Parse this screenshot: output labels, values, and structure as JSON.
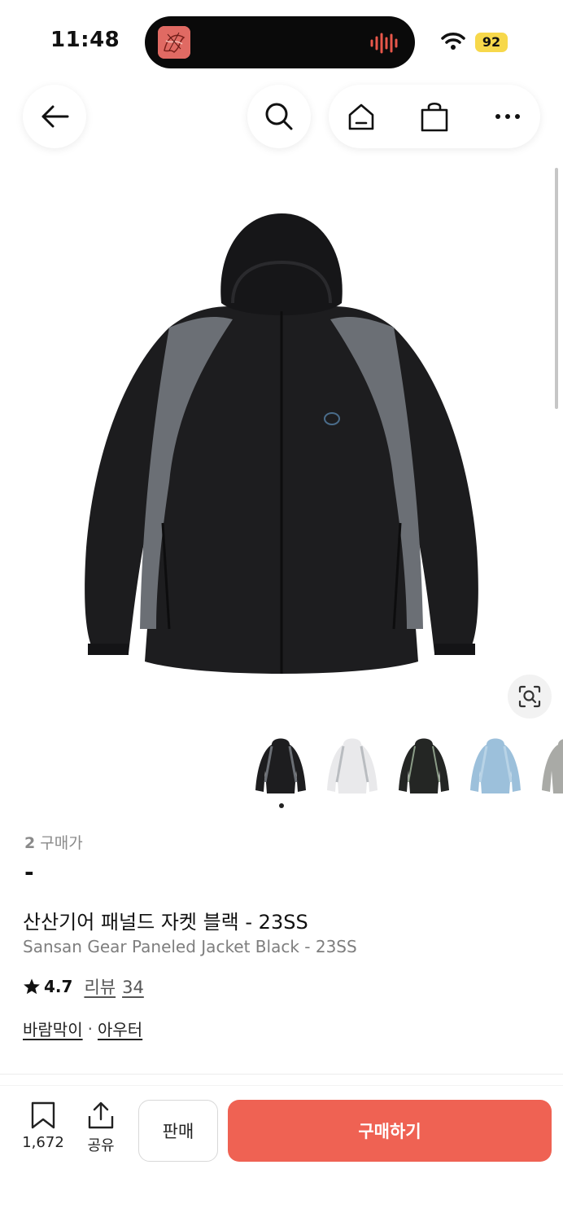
{
  "status_bar": {
    "time": "11:48",
    "battery": "92",
    "icons": [
      "album-art-icon",
      "audio-wave-icon",
      "wifi-icon",
      "battery-icon"
    ]
  },
  "nav": {
    "icons": [
      "back-arrow-icon",
      "search-icon",
      "home-icon",
      "shopping-bag-icon",
      "more-icon"
    ]
  },
  "product": {
    "image_search_icon": "image-search-icon",
    "thumbnails": [
      "black",
      "white",
      "dark-green",
      "light-blue",
      "gray"
    ],
    "trade_count": "2",
    "trade_label": "구매가",
    "price": "-",
    "title_ko": "산산기어 패널드 자켓 블랙 - 23SS",
    "title_en": "Sansan Gear Paneled Jacket Black - 23SS",
    "rating": "4.7",
    "review_label": "리뷰",
    "review_count": "34",
    "categories": [
      "바람막이",
      "아우터"
    ],
    "category_separator": "·"
  },
  "bottom_bar": {
    "bookmark_count": "1,672",
    "share_label": "공유",
    "sell_label": "판매",
    "buy_label": "구매하기"
  },
  "colors": {
    "accent": "#ef6253",
    "battery": "#f7d84b",
    "text_primary": "#111111",
    "text_secondary": "#7e7e7e"
  }
}
